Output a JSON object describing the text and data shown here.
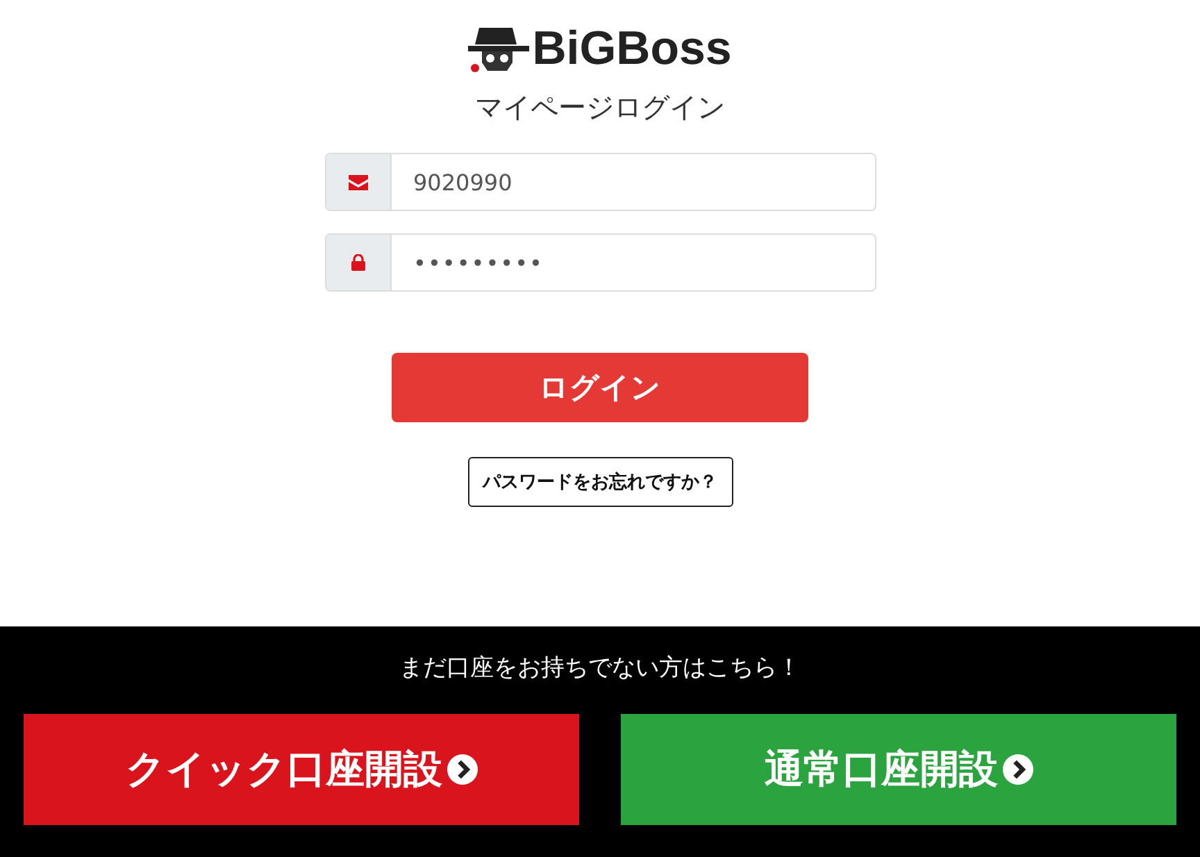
{
  "logo": {
    "text": "BiGBoss"
  },
  "title": "マイページログイン",
  "fields": [
    {
      "kind": "mail",
      "value": "9020990"
    },
    {
      "kind": "lock",
      "value": "•••••••••"
    }
  ],
  "login_button": "ログイン",
  "forgot_button": "パスワードをお忘れですか？",
  "footer": {
    "prompt": "まだ口座をお持ちでない方はこちら！",
    "buttons": [
      {
        "label": "クイック口座開設",
        "color": "#d9141d"
      },
      {
        "label": "通常口座開設",
        "color": "#2ba33f"
      }
    ]
  }
}
